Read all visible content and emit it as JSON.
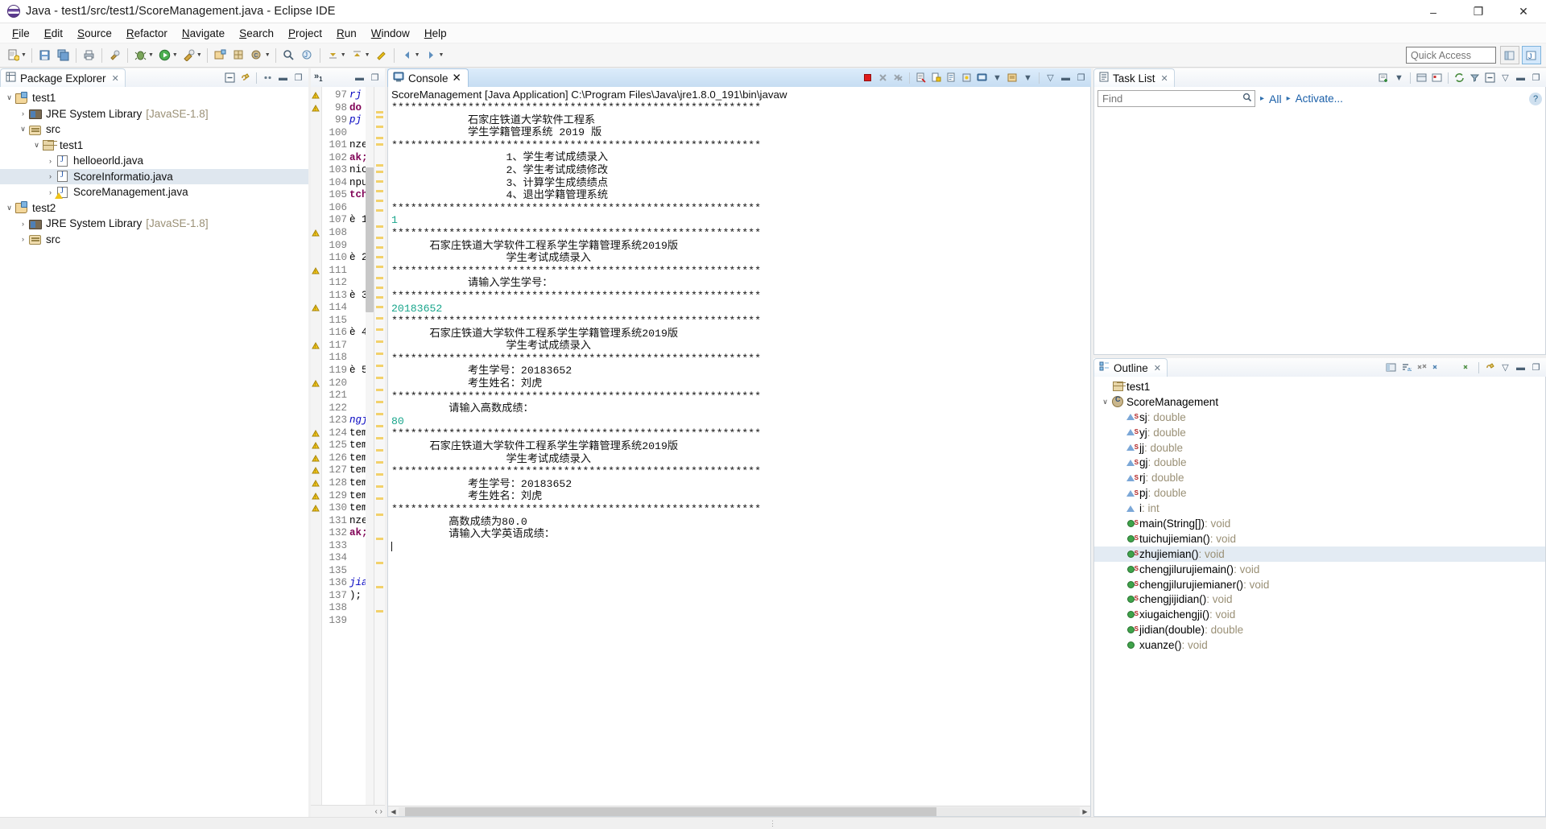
{
  "window": {
    "title": "Java - test1/src/test1/ScoreManagement.java - Eclipse IDE",
    "app_icon": "eclipse-icon",
    "minimize": "–",
    "maximize": "❐",
    "close": "✕"
  },
  "menubar": [
    {
      "label": "File"
    },
    {
      "label": "Edit"
    },
    {
      "label": "Source"
    },
    {
      "label": "Refactor"
    },
    {
      "label": "Navigate"
    },
    {
      "label": "Search"
    },
    {
      "label": "Project"
    },
    {
      "label": "Run"
    },
    {
      "label": "Window"
    },
    {
      "label": "Help"
    }
  ],
  "toolbar": {
    "quick_access_placeholder": "Quick Access",
    "buttons": [
      "new-wizard-icon",
      "save-icon",
      "save-all-icon",
      "print-icon",
      "undo-icon",
      "redo-icon",
      "build-icon",
      "debug-icon",
      "run-icon",
      "run-external-tools-icon",
      "new-java-project-icon",
      "new-class-icon",
      "search-icon",
      "open-type-icon",
      "next-annotation-icon",
      "previous-annotation-icon",
      "last-edit-location-icon",
      "back-icon",
      "forward-icon",
      "pin-editor-icon"
    ],
    "perspective_java": "java-perspective-icon",
    "perspective_open": "open-perspective-icon"
  },
  "package_explorer": {
    "tab_label": "Package Explorer",
    "close_icon": "close-icon",
    "tools": [
      "collapse-all-icon",
      "link-with-editor-icon",
      "view-menu-icon",
      "minimize-icon",
      "maximize-icon"
    ],
    "tree": [
      {
        "label": "test1",
        "suffix": "",
        "indent": 0,
        "twisty": "∨",
        "icon": "project-icon",
        "selected": false
      },
      {
        "label": "JRE System Library",
        "suffix": "[JavaSE-1.8]",
        "indent": 1,
        "twisty": "›",
        "icon": "jre-library-icon",
        "selected": false
      },
      {
        "label": "src",
        "suffix": "",
        "indent": 1,
        "twisty": "∨",
        "icon": "source-folder-icon",
        "selected": false
      },
      {
        "label": "test1",
        "suffix": "",
        "indent": 2,
        "twisty": "∨",
        "icon": "package-icon",
        "selected": false
      },
      {
        "label": "helloeorld.java",
        "suffix": "",
        "indent": 3,
        "twisty": "›",
        "icon": "java-file-icon",
        "selected": false
      },
      {
        "label": "ScoreInformatio.java",
        "suffix": "",
        "indent": 3,
        "twisty": "›",
        "icon": "java-file-icon",
        "selected": true
      },
      {
        "label": "ScoreManagement.java",
        "suffix": "",
        "indent": 3,
        "twisty": "›",
        "icon": "java-file-warning-icon",
        "selected": false
      },
      {
        "label": "test2",
        "suffix": "",
        "indent": 0,
        "twisty": "∨",
        "icon": "project-icon",
        "selected": false
      },
      {
        "label": "JRE System Library",
        "suffix": "[JavaSE-1.8]",
        "indent": 1,
        "twisty": "›",
        "icon": "jre-library-icon",
        "selected": false
      },
      {
        "label": "src",
        "suffix": "",
        "indent": 1,
        "twisty": "›",
        "icon": "source-folder-icon",
        "selected": false
      }
    ]
  },
  "editor": {
    "overflow_tab": "»",
    "overflow_count": "1",
    "minimize_icon": "minimize-icon",
    "maximize_icon": "maximize-icon",
    "lines": [
      {
        "num": "97",
        "code": "rj",
        "cls": "fld"
      },
      {
        "num": "98",
        "code": "do",
        "cls": "kw"
      },
      {
        "num": "99",
        "code": "pj",
        "cls": "fld"
      },
      {
        "num": "100",
        "code": "",
        "cls": ""
      },
      {
        "num": "101",
        "code": "nze",
        "cls": ""
      },
      {
        "num": "102",
        "code": "ak;",
        "cls": "kw"
      },
      {
        "num": "103",
        "code": "nic",
        "cls": ""
      },
      {
        "num": "104",
        "code": "npu",
        "cls": ""
      },
      {
        "num": "105",
        "code": "tch",
        "cls": "kw"
      },
      {
        "num": "106",
        "code": "",
        "cls": ""
      },
      {
        "num": "107",
        "code": "è 1",
        "cls": ""
      },
      {
        "num": "108",
        "code": "",
        "cls": ""
      },
      {
        "num": "109",
        "code": "",
        "cls": ""
      },
      {
        "num": "110",
        "code": "è 2",
        "cls": ""
      },
      {
        "num": "111",
        "code": "",
        "cls": ""
      },
      {
        "num": "112",
        "code": "",
        "cls": ""
      },
      {
        "num": "113",
        "code": "è 3",
        "cls": ""
      },
      {
        "num": "114",
        "code": "",
        "cls": ""
      },
      {
        "num": "115",
        "code": "",
        "cls": ""
      },
      {
        "num": "116",
        "code": "è 4",
        "cls": ""
      },
      {
        "num": "117",
        "code": "",
        "cls": ""
      },
      {
        "num": "118",
        "code": "",
        "cls": ""
      },
      {
        "num": "119",
        "code": "è 5",
        "cls": ""
      },
      {
        "num": "120",
        "code": "",
        "cls": ""
      },
      {
        "num": "121",
        "code": "",
        "cls": ""
      },
      {
        "num": "122",
        "code": "",
        "cls": ""
      },
      {
        "num": "123",
        "code": "ngj",
        "cls": "fld"
      },
      {
        "num": "124",
        "code": "tem",
        "cls": ""
      },
      {
        "num": "125",
        "code": "tem",
        "cls": ""
      },
      {
        "num": "126",
        "code": "tem",
        "cls": ""
      },
      {
        "num": "127",
        "code": "tem",
        "cls": ""
      },
      {
        "num": "128",
        "code": "tem",
        "cls": ""
      },
      {
        "num": "129",
        "code": "tem",
        "cls": ""
      },
      {
        "num": "130",
        "code": "tem",
        "cls": ""
      },
      {
        "num": "131",
        "code": "nze",
        "cls": ""
      },
      {
        "num": "132",
        "code": "ak;",
        "cls": "kw"
      },
      {
        "num": "133",
        "code": "",
        "cls": ""
      },
      {
        "num": "134",
        "code": "",
        "cls": ""
      },
      {
        "num": "135",
        "code": "",
        "cls": ""
      },
      {
        "num": "136",
        "code": "jia",
        "cls": "fld"
      },
      {
        "num": "137",
        "code": ");",
        "cls": ""
      },
      {
        "num": "138",
        "code": "",
        "cls": ""
      },
      {
        "num": "139",
        "code": "",
        "cls": ""
      }
    ],
    "footer_icons": "‹ ›"
  },
  "console": {
    "tab_label": "Console",
    "close_icon": "close-icon",
    "tools": [
      "terminate-icon",
      "remove-launch-icon",
      "remove-all-terminated-icon",
      "clear-console-icon",
      "scroll-lock-icon",
      "word-wrap-icon",
      "pin-console-icon",
      "display-selected-console-icon",
      "open-console-icon",
      "view-menu-icon",
      "minimize-icon",
      "maximize-icon"
    ],
    "launch_line": "ScoreManagement [Java Application] C:\\Program Files\\Java\\jre1.8.0_191\\bin\\javaw",
    "output": [
      {
        "t": "**********************************************************",
        "in": false
      },
      {
        "t": "            石家庄铁道大学软件工程系",
        "in": false
      },
      {
        "t": "            学生学籍管理系统 2019 版",
        "in": false
      },
      {
        "t": "**********************************************************",
        "in": false
      },
      {
        "t": "                  1、学生考试成绩录入",
        "in": false
      },
      {
        "t": "                  2、学生考试成绩修改",
        "in": false
      },
      {
        "t": "                  3、计算学生成绩绩点",
        "in": false
      },
      {
        "t": "                  4、退出学籍管理系统",
        "in": false
      },
      {
        "t": "**********************************************************",
        "in": false
      },
      {
        "t": "1",
        "in": true
      },
      {
        "t": "**********************************************************",
        "in": false
      },
      {
        "t": "      石家庄铁道大学软件工程系学生学籍管理系统2019版",
        "in": false
      },
      {
        "t": "                  学生考试成绩录入",
        "in": false
      },
      {
        "t": "**********************************************************",
        "in": false
      },
      {
        "t": "            请输入学生学号：",
        "in": false
      },
      {
        "t": "**********************************************************",
        "in": false
      },
      {
        "t": "20183652",
        "in": true
      },
      {
        "t": "**********************************************************",
        "in": false
      },
      {
        "t": "      石家庄铁道大学软件工程系学生学籍管理系统2019版",
        "in": false
      },
      {
        "t": "                  学生考试成绩录入",
        "in": false
      },
      {
        "t": "**********************************************************",
        "in": false
      },
      {
        "t": "            考生学号：20183652",
        "in": false
      },
      {
        "t": "            考生姓名：刘虎",
        "in": false
      },
      {
        "t": "**********************************************************",
        "in": false
      },
      {
        "t": "         请输入高数成绩：",
        "in": false
      },
      {
        "t": "80",
        "in": true
      },
      {
        "t": "**********************************************************",
        "in": false
      },
      {
        "t": "      石家庄铁道大学软件工程系学生学籍管理系统2019版",
        "in": false
      },
      {
        "t": "                  学生考试成绩录入",
        "in": false
      },
      {
        "t": "**********************************************************",
        "in": false
      },
      {
        "t": "            考生学号：20183652",
        "in": false
      },
      {
        "t": "            考生姓名：刘虎",
        "in": false
      },
      {
        "t": "**********************************************************",
        "in": false
      },
      {
        "t": "         高数成绩为80.0",
        "in": false
      },
      {
        "t": "         请输入大学英语成绩：",
        "in": false
      }
    ],
    "scroll_left_icon": "◀",
    "scroll_right_icon": "▶"
  },
  "task_list": {
    "tab_label": "Task List",
    "close_icon": "close-icon",
    "tools": [
      "new-task-icon",
      "categorize-icon",
      "focus-icon",
      "synchronize-icon",
      "filter-icon",
      "collapse-all-icon",
      "view-menu-icon",
      "minimize-icon",
      "maximize-icon"
    ],
    "find_placeholder": "Find",
    "find_value": "",
    "find_icon": "search-icon",
    "all_label": "All",
    "activate_label": "Activate...",
    "arrow_icon": "▸",
    "help_icon": "?"
  },
  "outline": {
    "tab_label": "Outline",
    "close_icon": "close-icon",
    "tools": [
      "sort-icon",
      "hide-fields-icon",
      "hide-static-icon",
      "hide-nonpublic-icon",
      "link-with-editor-icon",
      "view-menu-icon",
      "minimize-icon",
      "maximize-icon"
    ],
    "items": [
      {
        "label": "test1",
        "ret": "",
        "indent": 0,
        "icon": "package-icon",
        "twisty": "",
        "selected": false
      },
      {
        "label": "ScoreManagement",
        "ret": "",
        "indent": 0,
        "icon": "class-icon",
        "twisty": "∨",
        "selected": false
      },
      {
        "label": "sj",
        "ret": " : double",
        "indent": 1,
        "icon": "field-private-static-icon",
        "twisty": "",
        "selected": false
      },
      {
        "label": "yj",
        "ret": " : double",
        "indent": 1,
        "icon": "field-private-static-icon",
        "twisty": "",
        "selected": false
      },
      {
        "label": "jj",
        "ret": " : double",
        "indent": 1,
        "icon": "field-private-static-icon",
        "twisty": "",
        "selected": false
      },
      {
        "label": "gj",
        "ret": " : double",
        "indent": 1,
        "icon": "field-private-static-icon",
        "twisty": "",
        "selected": false
      },
      {
        "label": "rj",
        "ret": " : double",
        "indent": 1,
        "icon": "field-private-static-icon",
        "twisty": "",
        "selected": false
      },
      {
        "label": "pj",
        "ret": " : double",
        "indent": 1,
        "icon": "field-private-static-icon",
        "twisty": "",
        "selected": false
      },
      {
        "label": "i",
        "ret": " : int",
        "indent": 1,
        "icon": "field-private-icon",
        "twisty": "",
        "selected": false
      },
      {
        "label": "main(String[])",
        "ret": " : void",
        "indent": 1,
        "icon": "method-public-static-icon",
        "twisty": "",
        "selected": false
      },
      {
        "label": "tuichujiemian()",
        "ret": " : void",
        "indent": 1,
        "icon": "method-public-static-icon",
        "twisty": "",
        "selected": false
      },
      {
        "label": "zhujiemian()",
        "ret": " : void",
        "indent": 1,
        "icon": "method-public-static-icon",
        "twisty": "",
        "selected": true
      },
      {
        "label": "chengjilurujiemain()",
        "ret": " : void",
        "indent": 1,
        "icon": "method-public-static-icon",
        "twisty": "",
        "selected": false
      },
      {
        "label": "chengjilurujiemianer()",
        "ret": " : void",
        "indent": 1,
        "icon": "method-public-static-icon",
        "twisty": "",
        "selected": false
      },
      {
        "label": "chengjijidian()",
        "ret": " : void",
        "indent": 1,
        "icon": "method-public-static-icon",
        "twisty": "",
        "selected": false
      },
      {
        "label": "xiugaichengji()",
        "ret": " : void",
        "indent": 1,
        "icon": "method-public-static-icon",
        "twisty": "",
        "selected": false
      },
      {
        "label": "jidian(double)",
        "ret": " : double",
        "indent": 1,
        "icon": "method-public-static-icon",
        "twisty": "",
        "selected": false
      },
      {
        "label": "xuanze()",
        "ret": " : void",
        "indent": 1,
        "icon": "method-public-icon",
        "twisty": "",
        "selected": false
      }
    ]
  },
  "statusbar": {
    "grip": "⋮"
  },
  "colors": {
    "console_input": "#19a68c",
    "tab_active": "#ffffff",
    "selection": "#dfe7ef",
    "link": "#1a5fa8",
    "suffix": "#9a9076"
  }
}
